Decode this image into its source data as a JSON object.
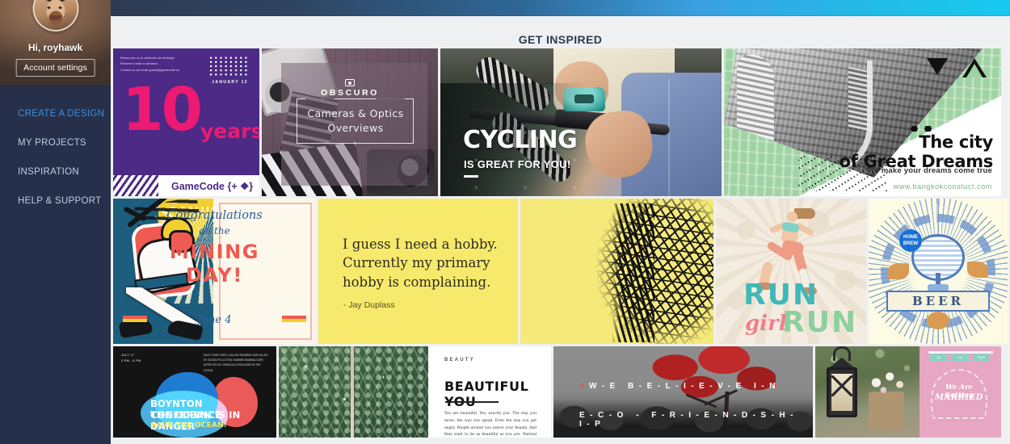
{
  "sidebar": {
    "greeting": "Hi, royhawk",
    "account_button": "Account settings",
    "nav": [
      {
        "label": "CREATE A DESIGN",
        "active": true
      },
      {
        "label": "MY PROJECTS",
        "active": false
      },
      {
        "label": "INSPIRATION",
        "active": false
      },
      {
        "label": "HELP & SUPPORT",
        "active": false
      }
    ],
    "colors": {
      "background": "#26304b",
      "active": "#3d8ee0",
      "inactive": "#c3cbdd"
    }
  },
  "header": {
    "title": "GET INSPIRED",
    "gradient_from": "#2d3a52",
    "gradient_to": "#18c9ee"
  },
  "gallery": {
    "rows": [
      {
        "cards": [
          {
            "name": "gamecode-10-years",
            "invite_lines": "Please join us to celebrate our birthday!\nReserve a table in advance.\nContact us via email guests@gamecode.us",
            "date": "JANUARY 12",
            "number": "10",
            "years": "years",
            "brand": "GameCode {+ ❖}"
          },
          {
            "name": "obscuro-cameras",
            "title": "OBSCURO",
            "subtitle": "Cameras & Optics\nOverviews"
          },
          {
            "name": "cycling-poster",
            "title": "CYCLING",
            "subtitle": "IS GREAT FOR YOU!"
          },
          {
            "name": "city-of-great-dreams",
            "title": "The city\nof Great Dreams",
            "subtitle": "We make your dreams come true",
            "url": "www.bangkokconstuct.com"
          }
        ]
      },
      {
        "cards": [
          {
            "name": "mining-day-card",
            "congrats": "Congratulations",
            "onthe": "on the",
            "big": "MINING\nDAY!",
            "date": "June 4"
          },
          {
            "name": "hobby-quote",
            "quote": "I guess I need a hobby. Currently my primary hobby is complaining.",
            "author": "- Jay Duplass"
          },
          {
            "name": "scribble-face-art",
            "title": ""
          },
          {
            "name": "run-girl-run",
            "run_top": "RUN",
            "girl": "girl",
            "run_bottom": "RUN"
          },
          {
            "name": "beer-badge",
            "badge_top": "HOME\nBREW",
            "ribbon": "BEER"
          }
        ]
      },
      {
        "cards": [
          {
            "name": "boynton-conference",
            "meta": "JULY 17\n3 PM - 8 PM",
            "paragraph": "EACH YEAR OVER 1,000,000 SEABIRDS ARE KILLED BY OCEAN POLLUTION. MARINE MAMMALS ARE AFFECTED BY CHEMICALS RELEASED IN THE OCEAN.",
            "line1": "BOYNTON CONFERENCE",
            "line2": "THE OCEAN IS IN DANGER",
            "line3": "SAVE THE OCEAN!"
          },
          {
            "name": "beautiful-you",
            "kicker": "BEAUTY",
            "title": "BEAUTIFUL YOU",
            "body": "You are beautiful. Yes, exactly you. The way you move, the way you speak. Even the way you get angry. People around you notice your beauty. And they want to be as beautiful as you are. Natural beauty is deep."
          },
          {
            "name": "eco-friendship",
            "line1": "W-E  B-E-L-I-E-V-E  I-N",
            "line2": "E-C-O - F-R-I-E-N-D-S-H-I-P"
          },
          {
            "name": "getting-married",
            "flags": [
              "25",
              "16",
              "2019"
            ],
            "line1": "We Are Getting",
            "line2": "MARRIED"
          }
        ]
      }
    ]
  }
}
